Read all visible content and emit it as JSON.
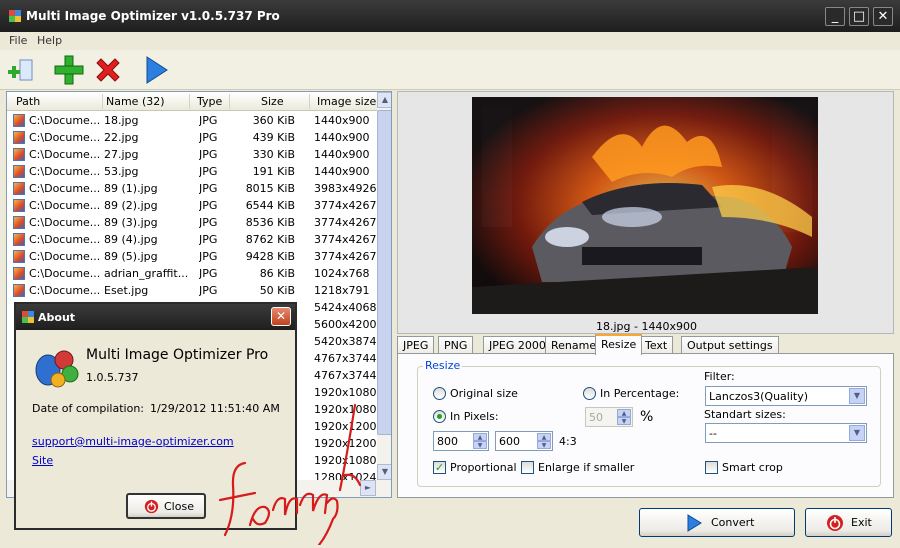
{
  "window": {
    "title": "Multi Image Optimizer v1.0.5.737 Pro",
    "minimize": "_",
    "maximize": "□",
    "close": "✕"
  },
  "menu": [
    "File",
    "Help"
  ],
  "toolbar": {
    "icons": [
      "add-folder-icon",
      "add-icon",
      "remove-icon",
      "play-icon"
    ]
  },
  "list": {
    "columns": [
      "Path",
      "Name (32)",
      "Type",
      "Size",
      "Image size"
    ],
    "rows": [
      [
        "C:\\Docume...",
        "18.jpg",
        "JPG",
        "360 KiB",
        "1440x900"
      ],
      [
        "C:\\Docume...",
        "22.jpg",
        "JPG",
        "439 KiB",
        "1440x900"
      ],
      [
        "C:\\Docume...",
        "27.jpg",
        "JPG",
        "330 KiB",
        "1440x900"
      ],
      [
        "C:\\Docume...",
        "53.jpg",
        "JPG",
        "191 KiB",
        "1440x900"
      ],
      [
        "C:\\Docume...",
        "89 (1).jpg",
        "JPG",
        "8015 KiB",
        "3983x4926"
      ],
      [
        "C:\\Docume...",
        "89 (2).jpg",
        "JPG",
        "6544 KiB",
        "3774x4267"
      ],
      [
        "C:\\Docume...",
        "89 (3).jpg",
        "JPG",
        "8536 KiB",
        "3774x4267"
      ],
      [
        "C:\\Docume...",
        "89 (4).jpg",
        "JPG",
        "8762 KiB",
        "3774x4267"
      ],
      [
        "C:\\Docume...",
        "89 (5).jpg",
        "JPG",
        "9428 KiB",
        "3774x4267"
      ],
      [
        "C:\\Docume...",
        "adrian_graffit...",
        "JPG",
        "86 KiB",
        "1024x768"
      ],
      [
        "C:\\Docume...",
        "Eset.jpg",
        "JPG",
        "50 KiB",
        "1218x791"
      ],
      [
        "",
        "",
        "",
        "",
        "5424x4068"
      ],
      [
        "",
        "",
        "",
        "",
        "5600x4200"
      ],
      [
        "",
        "",
        "",
        "",
        "5420x3874"
      ],
      [
        "",
        "",
        "",
        "",
        "4767x3744"
      ],
      [
        "",
        "",
        "",
        "",
        "4767x3744"
      ],
      [
        "",
        "",
        "",
        "",
        "1920x1080"
      ],
      [
        "",
        "",
        "",
        "",
        "1920x1080"
      ],
      [
        "",
        "",
        "",
        "",
        "1920x1200"
      ],
      [
        "",
        "",
        "",
        "",
        "1920x1200"
      ],
      [
        "",
        "",
        "",
        "",
        "1920x1080"
      ],
      [
        "",
        "",
        "",
        "",
        "1280x1024"
      ]
    ]
  },
  "preview": {
    "caption": "18.jpg - 1440x900"
  },
  "tabs": [
    "JPEG",
    "PNG",
    "JPEG 2000",
    "Rename",
    "Resize",
    "Text",
    "Output settings"
  ],
  "resize": {
    "group_label": "Resize",
    "original_size": "Original size",
    "in_percentage": "In Percentage:",
    "in_pixels": "In Pixels:",
    "percent_value": "50",
    "percent_sign": "%",
    "width": "800",
    "height": "600",
    "ratio": "4:3",
    "proportional": "Proportional",
    "enlarge": "Enlarge if smaller",
    "filter_label": "Filter:",
    "filter_value": "Lanczos3(Quality)",
    "standard_sizes_label": "Standart sizes:",
    "standard_sizes_value": "--",
    "smart_crop": "Smart crop"
  },
  "buttons": {
    "convert": "Convert",
    "exit": "Exit"
  },
  "about": {
    "title": "About",
    "close_x": "✕",
    "product": "Multi Image Optimizer Pro",
    "version": "1.0.5.737",
    "compilation_label": "Date of compilation:",
    "compilation_value": "1/29/2012 11:51:40 AM",
    "email": "support@multi-image-optimizer.com",
    "site": "Site",
    "close_button": "Close"
  },
  "signature": "fonnyk",
  "colors": {
    "accent_tab": "#f8a830",
    "link": "#0000cc",
    "group_label": "#0046d5"
  }
}
